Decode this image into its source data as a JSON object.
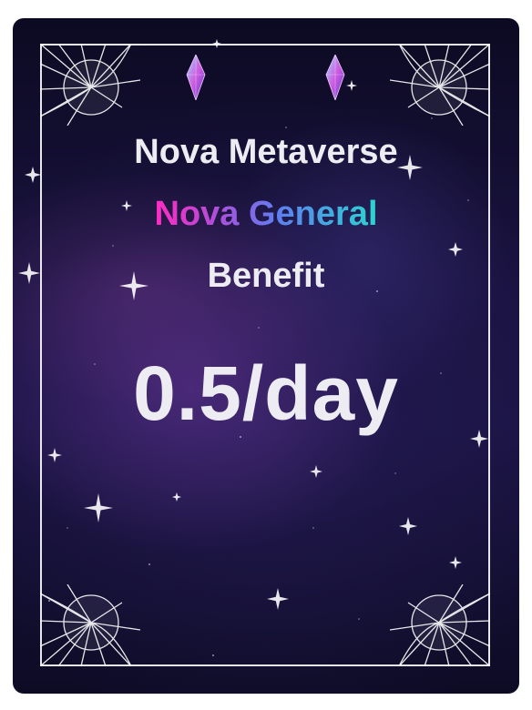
{
  "card": {
    "title": "Nova Metaverse",
    "subtitle": "Nova General",
    "label": "Benefit",
    "value": "0.5/day"
  },
  "icons": {
    "corner": "fan-ornament-icon",
    "crystal": "crystal-icon",
    "sparkle": "sparkle-icon"
  },
  "colors": {
    "background_dark": "#0c0a22",
    "nebula_purple": "#7a3caa",
    "text": "#ececf2",
    "gradient_start": "#ff2bc2",
    "gradient_end": "#2ad6d0"
  }
}
